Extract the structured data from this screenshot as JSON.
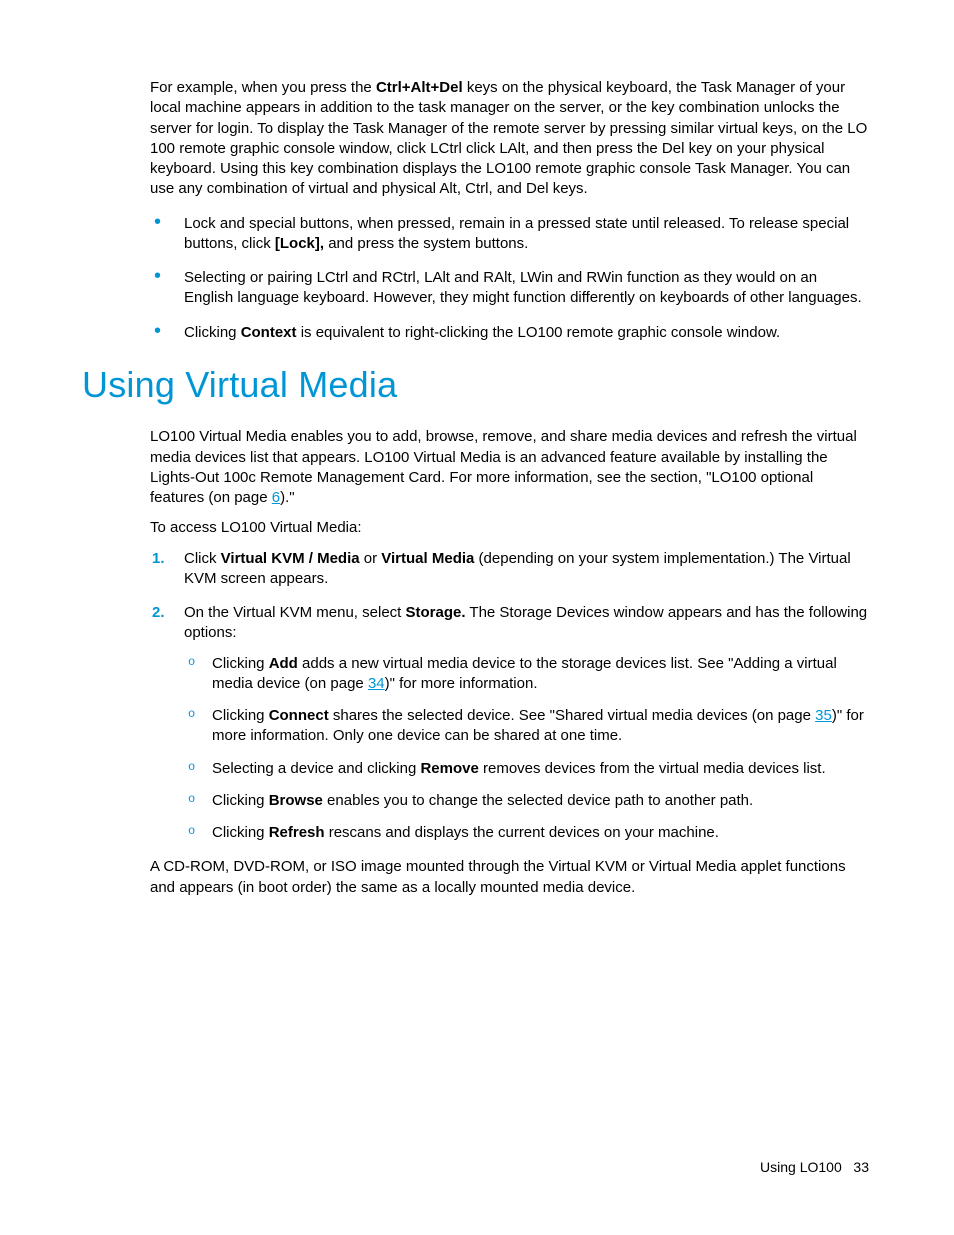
{
  "intro": {
    "p1_a": "For example, when you press the ",
    "p1_b": "Ctrl+Alt+Del",
    "p1_c": " keys on the physical keyboard, the Task Manager of your local machine appears in addition to the task manager on the server, or the key combination unlocks the server for login. To display the Task Manager of the remote server by pressing similar virtual keys, on the LO 100 remote graphic console window, click LCtrl click LAlt, and then press the Del key on your physical keyboard. Using this key combination displays the LO100 remote graphic console Task Manager. You can use any combination of virtual and physical Alt, Ctrl, and Del keys."
  },
  "bullets": {
    "b1_a": "Lock and special buttons, when pressed, remain in a pressed state until released. To release special buttons, click ",
    "b1_b": "[Lock],",
    "b1_c": " and press the system buttons.",
    "b2": "Selecting or pairing LCtrl and RCtrl, LAlt and RAlt, LWin and RWin function as they would on an English language keyboard. However, they might function differently on keyboards of other languages.",
    "b3_a": "Clicking ",
    "b3_b": "Context",
    "b3_c": " is equivalent to right-clicking the LO100 remote graphic console window."
  },
  "heading": "Using Virtual Media",
  "vm": {
    "p1_a": "LO100 Virtual Media enables you to add, browse, remove, and share media devices and refresh the virtual media devices list that appears. LO100 Virtual Media is an advanced feature available by installing the Lights-Out 100c Remote Management Card. For more information, see the section, \"LO100 optional features (on page ",
    "p1_link": "6",
    "p1_b": ").\"",
    "p2": "To access LO100 Virtual Media:"
  },
  "steps": {
    "s1_a": "Click ",
    "s1_b": "Virtual KVM / Media",
    "s1_c": " or ",
    "s1_d": "Virtual Media",
    "s1_e": " (depending on your system implementation.) The Virtual KVM screen appears.",
    "s2_a": "On the Virtual KVM menu, select ",
    "s2_b": "Storage.",
    "s2_c": " The Storage Devices window appears and has the following options:"
  },
  "sub": {
    "a_a": "Clicking ",
    "a_b": "Add",
    "a_c": " adds a new virtual media device to the storage devices list. See \"Adding a virtual media device (on page ",
    "a_link": "34",
    "a_d": ")\" for more information.",
    "b_a": "Clicking ",
    "b_b": "Connect",
    "b_c": " shares the selected device. See \"Shared virtual media devices (on page ",
    "b_link": "35",
    "b_d": ")\" for more information. Only one device can be shared at one time.",
    "c_a": "Selecting a device and clicking ",
    "c_b": "Remove",
    "c_c": " removes devices from the virtual media devices list.",
    "d_a": "Clicking ",
    "d_b": "Browse",
    "d_c": " enables you to change the selected device path to another path.",
    "e_a": "Clicking ",
    "e_b": "Refresh",
    "e_c": " rescans and displays the current devices on your machine."
  },
  "closing": "A CD-ROM, DVD-ROM, or ISO image mounted through the Virtual KVM or Virtual Media applet functions and appears (in boot order) the same as a locally mounted media device.",
  "footer": {
    "label": "Using LO100",
    "page": "33"
  }
}
